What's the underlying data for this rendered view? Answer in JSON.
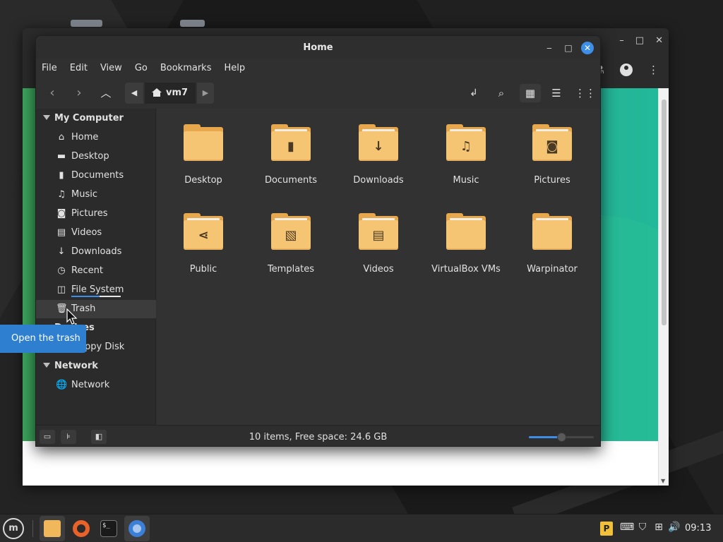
{
  "window": {
    "title": "Home",
    "minimize_glyph": "‒",
    "maximize_glyph": "□",
    "close_glyph": "✕"
  },
  "menubar": [
    "File",
    "Edit",
    "View",
    "Go",
    "Bookmarks",
    "Help"
  ],
  "toolbar": {
    "path_crumb": "vm7",
    "icons": [
      "back-icon",
      "forward-icon",
      "up-icon",
      "terminal-icon",
      "search-icon",
      "grid-view-icon",
      "list-view-icon",
      "compact-view-icon"
    ]
  },
  "sidebar": {
    "sections": [
      {
        "title": "My Computer",
        "items": [
          {
            "label": "Home",
            "icon": "home-icon"
          },
          {
            "label": "Desktop",
            "icon": "desktop-icon"
          },
          {
            "label": "Documents",
            "icon": "document-icon"
          },
          {
            "label": "Music",
            "icon": "music-icon"
          },
          {
            "label": "Pictures",
            "icon": "camera-icon"
          },
          {
            "label": "Videos",
            "icon": "film-icon"
          },
          {
            "label": "Downloads",
            "icon": "download-icon"
          },
          {
            "label": "Recent",
            "icon": "clock-icon"
          },
          {
            "label": "File System",
            "icon": "drive-icon"
          },
          {
            "label": "Trash",
            "icon": "trash-icon"
          }
        ]
      },
      {
        "title": "Devices",
        "items": [
          {
            "label": "Floppy Disk",
            "icon": "floppy-icon"
          }
        ]
      },
      {
        "title": "Network",
        "items": [
          {
            "label": "Network",
            "icon": "globe-icon"
          }
        ]
      }
    ],
    "selected": "Trash"
  },
  "tooltip": "Open the trash",
  "files": [
    {
      "name": "Desktop",
      "emblem": ""
    },
    {
      "name": "Documents",
      "emblem": "document"
    },
    {
      "name": "Downloads",
      "emblem": "download"
    },
    {
      "name": "Music",
      "emblem": "music"
    },
    {
      "name": "Pictures",
      "emblem": "camera"
    },
    {
      "name": "Public",
      "emblem": "share"
    },
    {
      "name": "Templates",
      "emblem": "template"
    },
    {
      "name": "Videos",
      "emblem": "film"
    },
    {
      "name": "VirtualBox VMs",
      "emblem": ""
    },
    {
      "name": "Warpinator",
      "emblem": ""
    }
  ],
  "statusbar": {
    "text": "10 items, Free space: 24.6 GB",
    "zoom_level": 0.5
  },
  "taskbar": {
    "apps": [
      "Files",
      "Firefox",
      "Terminal",
      "Chromium"
    ],
    "active_app": "Files",
    "terminal_glyph": "$_",
    "tray_icons": [
      "update-manager-icon",
      "keyboard-icon",
      "shield-icon",
      "network-icon",
      "volume-icon"
    ],
    "clock": "09:13"
  },
  "colors": {
    "accent": "#3c8ee8",
    "folder": "#f6c574",
    "window_bg": "#323232",
    "sidebar_bg": "#2b2b2b",
    "tooltip_bg": "#2f7fd0"
  }
}
